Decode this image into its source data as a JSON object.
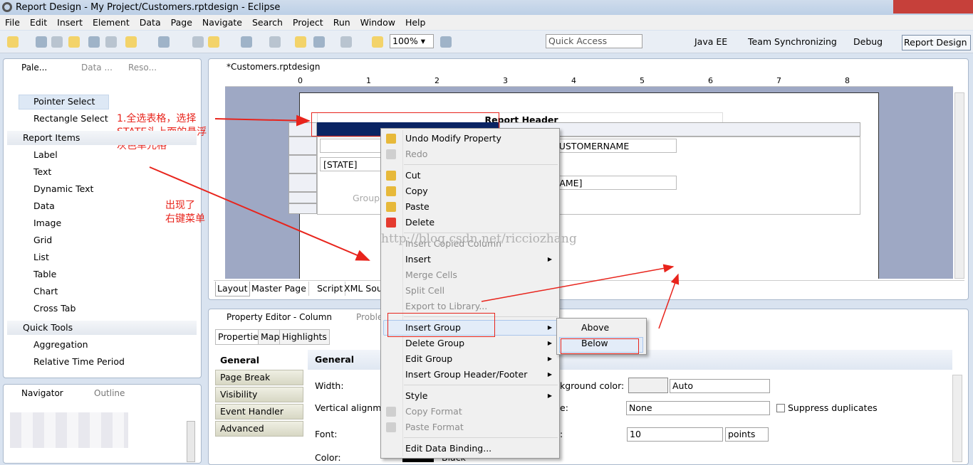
{
  "window": {
    "title": "Report Design - My Project/Customers.rptdesign - Eclipse"
  },
  "menu": [
    "File",
    "Edit",
    "Insert",
    "Element",
    "Data",
    "Page",
    "Navigate",
    "Search",
    "Project",
    "Run",
    "Window",
    "Help"
  ],
  "toolbar": {
    "zoom": "100%",
    "quick_access": "Quick Access",
    "perspectives": [
      "Java EE",
      "Team Synchronizing",
      "Debug",
      "Report Design"
    ]
  },
  "palette": {
    "tabs": [
      "Pale...",
      "Data ...",
      "Reso..."
    ],
    "tools": [
      "Pointer Select",
      "Rectangle Select"
    ],
    "report_items_title": "Report Items",
    "report_items": [
      "Label",
      "Text",
      "Dynamic Text",
      "Data",
      "Image",
      "Grid",
      "List",
      "Table",
      "Chart",
      "Cross Tab"
    ],
    "quick_tools_title": "Quick Tools",
    "quick_tools": [
      "Aggregation",
      "Relative Time Period"
    ]
  },
  "navigator": {
    "tabs": [
      "Navigator",
      "Outline"
    ]
  },
  "editor": {
    "tab": "*Customers.rptdesign",
    "ruler": [
      "0",
      "1",
      "2",
      "3",
      "4",
      "5",
      "6",
      "7",
      "8"
    ],
    "report_header": "Report Header",
    "cells": {
      "customername": "CUSTOMERNAME",
      "state": "[STATE]",
      "name": "NAME]",
      "group": "Group"
    },
    "bottom_tabs": [
      "Layout",
      "Master Page",
      "Script",
      "XML Source"
    ],
    "watermark": "http://blog.csdn.net/ricciozhang"
  },
  "context_menu": [
    {
      "label": "Undo Modify Property",
      "enabled": true,
      "icon": "undo-icon"
    },
    {
      "label": "Redo",
      "enabled": false,
      "icon": "redo-icon"
    },
    {
      "label": "Cut",
      "enabled": true,
      "icon": "scissors-icon",
      "sep": true
    },
    {
      "label": "Copy",
      "enabled": true,
      "icon": "copy-icon"
    },
    {
      "label": "Paste",
      "enabled": true,
      "icon": "paste-icon"
    },
    {
      "label": "Delete",
      "enabled": true,
      "icon": "delete-icon"
    },
    {
      "label": "Insert Copied Column",
      "enabled": false,
      "sep": true
    },
    {
      "label": "Insert",
      "enabled": true,
      "submenu": true
    },
    {
      "label": "Merge Cells",
      "enabled": false
    },
    {
      "label": "Split Cell",
      "enabled": false
    },
    {
      "label": "Export to Library...",
      "enabled": false
    },
    {
      "label": "Insert Group",
      "enabled": true,
      "submenu": true,
      "highlighted": true,
      "sep": true
    },
    {
      "label": "Delete Group",
      "enabled": true,
      "submenu": true
    },
    {
      "label": "Edit Group",
      "enabled": true,
      "submenu": true
    },
    {
      "label": "Insert Group Header/Footer",
      "enabled": true,
      "submenu": true
    },
    {
      "label": "Style",
      "enabled": true,
      "submenu": true,
      "sep": true
    },
    {
      "label": "Copy Format",
      "enabled": false,
      "icon": "copy-format-icon"
    },
    {
      "label": "Paste Format",
      "enabled": false,
      "icon": "paste-format-icon"
    },
    {
      "label": "Edit Data Binding...",
      "enabled": true,
      "sep": true
    }
  ],
  "submenu": [
    "Above",
    "Below"
  ],
  "property_editor": {
    "tab": "Property Editor - Column",
    "tab2": "Proble",
    "subtabs": [
      "Properties",
      "Map",
      "Highlights"
    ],
    "categories": [
      "General",
      "Page Break",
      "Visibility",
      "Event Handler",
      "Advanced"
    ],
    "section": "General",
    "labels": {
      "width": "Width:",
      "valign": "Vertical alignme",
      "font": "Font:",
      "color": "Color:",
      "bg": "kground color:",
      "style": "e:",
      "size": ":"
    },
    "values": {
      "bg": "Auto",
      "style": "None",
      "suppress": "Suppress duplicates",
      "size": "10",
      "unit": "points",
      "color": "Black"
    }
  },
  "annotations": {
    "step1": [
      "1.全选表格，选择",
      "STATE头上面的悬浮",
      "灰色单元格"
    ],
    "menu_appeared": [
      "出现了",
      "右键菜单"
    ]
  },
  "colors": {
    "annotation": "#e8241c",
    "selection": "#0a2463"
  }
}
